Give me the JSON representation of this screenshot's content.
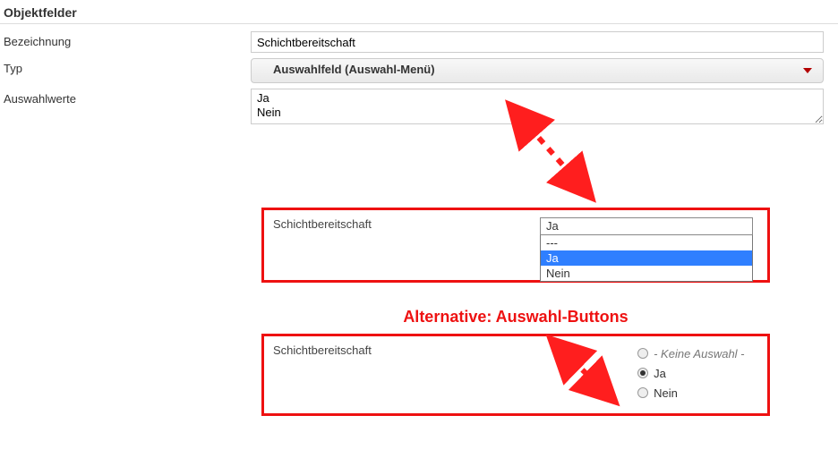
{
  "section_title": "Objektfelder",
  "form": {
    "bezeichnung_label": "Bezeichnung",
    "bezeichnung_value": "Schichtbereitschaft",
    "typ_label": "Typ",
    "typ_value": "Auswahlfeld (Auswahl-Menü)",
    "auswahlwerte_label": "Auswahlwerte",
    "auswahlwerte_value": "Ja\nNein"
  },
  "preview_dropdown": {
    "label": "Schichtbereitschaft",
    "current": "Ja",
    "options": [
      "---",
      "Ja",
      "Nein"
    ],
    "selected_index": 1
  },
  "alternative_heading": "Alternative: Auswahl-Buttons",
  "preview_radio": {
    "label": "Schichtbereitschaft",
    "options": [
      {
        "text": "- Keine Auswahl -",
        "italic": true,
        "selected": false
      },
      {
        "text": "Ja",
        "italic": false,
        "selected": true
      },
      {
        "text": "Nein",
        "italic": false,
        "selected": false
      }
    ]
  }
}
